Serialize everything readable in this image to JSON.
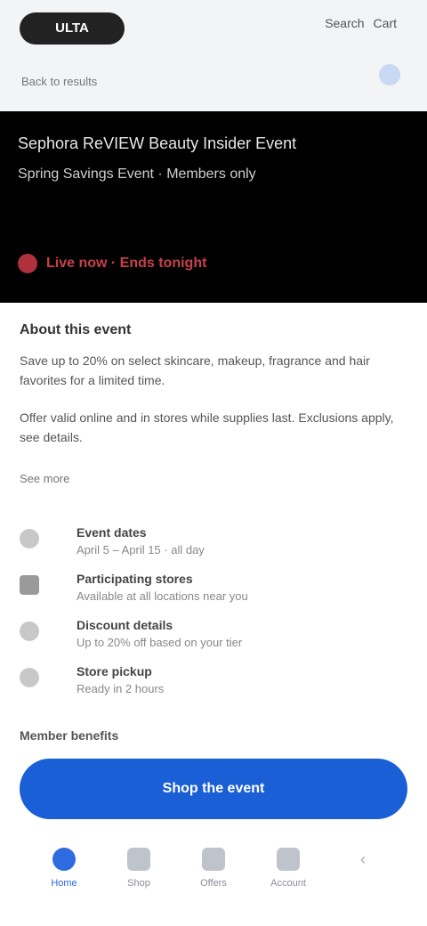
{
  "header": {
    "logo": "ULTA",
    "actions": [
      "Search",
      "Cart"
    ],
    "subtitle": "Back to results"
  },
  "hero": {
    "title": "Sephora ReVIEW Beauty Insider Event",
    "subtitle": "Spring Savings Event · Members only",
    "live_label": "Live now · Ends tonight"
  },
  "content": {
    "section_title": "About this event",
    "paragraph1": "Save up to 20% on select skincare, makeup, fragrance and hair favorites for a limited time.",
    "paragraph2": "Offer valid online and in stores while supplies last. Exclusions apply, see details.",
    "more_link": "See more"
  },
  "info": [
    {
      "icon": "calendar-icon",
      "title": "Event dates",
      "sub": "April 5 – April 15 · all day"
    },
    {
      "icon": "store-icon",
      "title": "Participating stores",
      "sub": "Available at all locations near you"
    },
    {
      "icon": "tag-icon",
      "title": "Discount details",
      "sub": "Up to 20% off based on your tier"
    },
    {
      "icon": "pin-icon",
      "title": "Store pickup",
      "sub": "Ready in 2 hours"
    }
  ],
  "bottom_heading": "Member benefits",
  "cta": {
    "label": "Shop the event"
  },
  "tabs": [
    {
      "label": "Home",
      "active": true
    },
    {
      "label": "Shop",
      "active": false
    },
    {
      "label": "Offers",
      "active": false
    },
    {
      "label": "Account",
      "active": false
    }
  ],
  "colors": {
    "accent": "#1a5fd6",
    "hero_bg": "#000000",
    "live": "#b0303c"
  }
}
